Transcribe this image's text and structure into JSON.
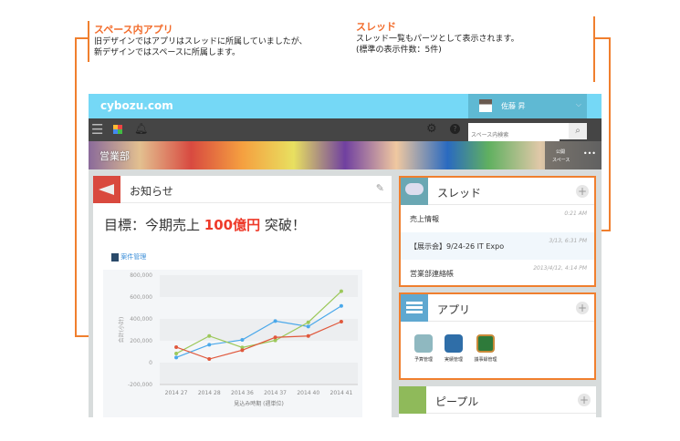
{
  "annotations": {
    "space_app": {
      "title": "スペース内アプリ",
      "lines": [
        "旧デザインではアプリはスレッドに所属していましたが、",
        "新デザインではスペースに所属します。"
      ]
    },
    "thread": {
      "title": "スレッド",
      "lines": [
        "スレッド一覧もパーツとして表示されます。",
        "(標準の表示件数：5件)"
      ]
    }
  },
  "header": {
    "logo": "cybozu.com",
    "user_name": "佐藤 昇",
    "search_placeholder": "スペース内検索"
  },
  "banner": {
    "space_name": "営業部",
    "public_label_1": "公開",
    "public_label_2": "スペース",
    "more": "•••"
  },
  "notice": {
    "title": "お知らせ",
    "headline_pre": "目標：今期売上 ",
    "headline_emph": "100億円",
    "headline_post": " 突破！",
    "app_link": "案件管理"
  },
  "thread_panel": {
    "title": "スレッド",
    "items": [
      {
        "title": "売上情報",
        "date": "0:21 AM"
      },
      {
        "title": "【展示会】9/24-26 IT Expo",
        "date": "3/13, 6:31 PM"
      },
      {
        "title": "営業部連絡帳",
        "date": "2013/4/12, 4:14 PM"
      }
    ]
  },
  "app_panel": {
    "title": "アプリ",
    "apps": [
      {
        "label": "予算管理"
      },
      {
        "label": "実績管理"
      },
      {
        "label": "議事録管理"
      }
    ]
  },
  "people_panel": {
    "title": "ピープル"
  },
  "colors": {
    "accent": "#f07f2e",
    "header": "#75d8f6"
  },
  "chart_data": {
    "type": "line",
    "categories": [
      "2014 27",
      "2014 28",
      "2014 36",
      "2014 37",
      "2014 40",
      "2014 41"
    ],
    "xlabel": "見込み時期 (週単位)",
    "ylabel": "合計(小計)",
    "ylim": [
      -200000,
      800000
    ],
    "yticks": [
      "800,000",
      "600,000",
      "400,000",
      "200,000",
      "0",
      "-200,000"
    ],
    "series": [
      {
        "name": "blue",
        "color": "#4aa8ea",
        "values": [
          47000,
          164000,
          208000,
          380000,
          330000,
          519000
        ]
      },
      {
        "name": "green",
        "color": "#9cc85a",
        "values": [
          83000,
          244000,
          139000,
          203000,
          369000,
          653000
        ]
      },
      {
        "name": "red",
        "color": "#e0583c",
        "values": [
          142000,
          33000,
          114000,
          231000,
          244000,
          375000
        ]
      }
    ]
  }
}
